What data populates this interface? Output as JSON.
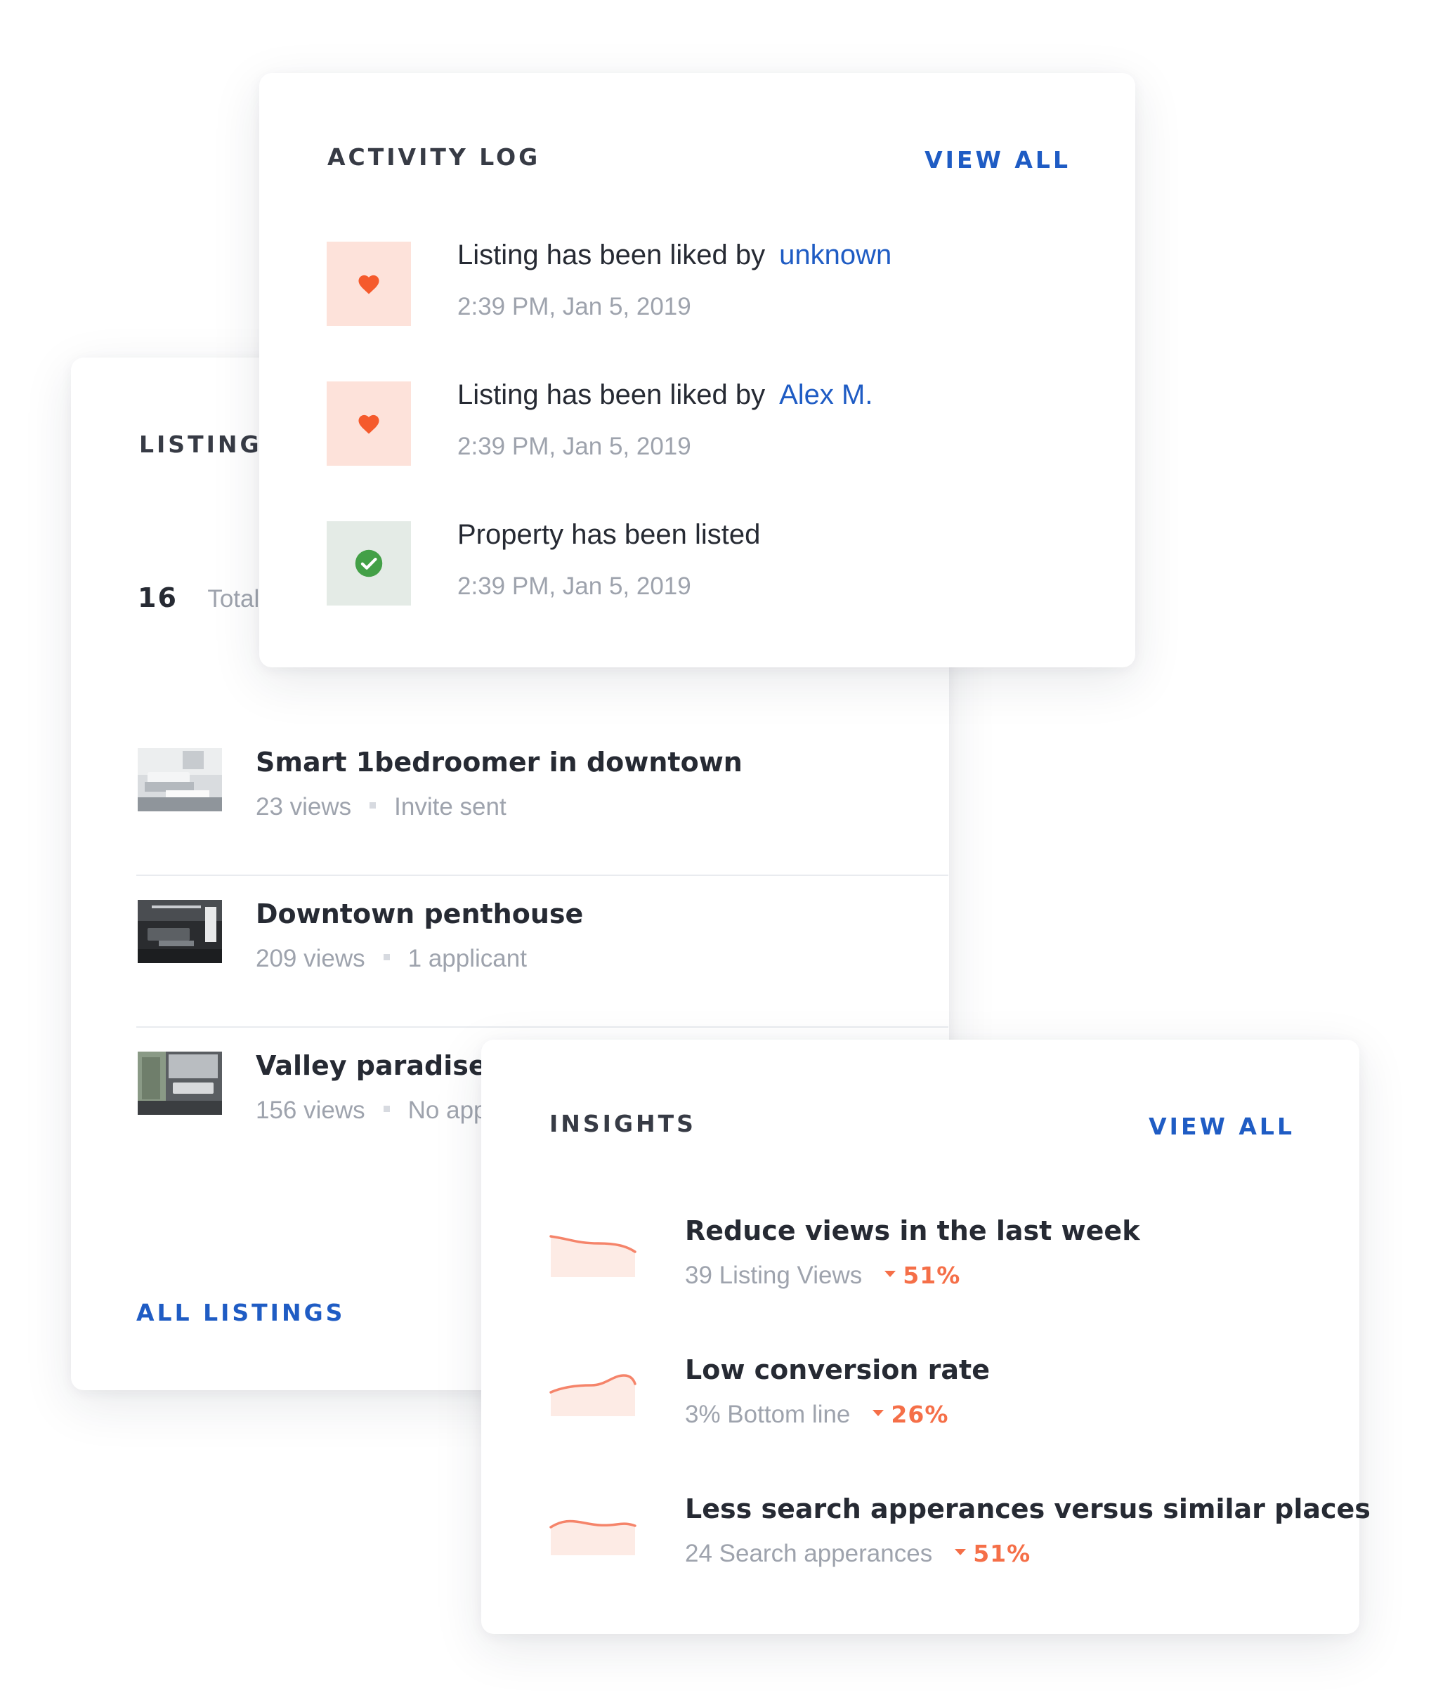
{
  "listings": {
    "heading": "LISTINGS",
    "total_count": "16",
    "total_label": "Total",
    "items": [
      {
        "title": "Smart 1bedroomer in downtown",
        "views": "23 views",
        "status": "Invite sent"
      },
      {
        "title": "Downtown penthouse",
        "views": "209 views",
        "status": "1 applicant"
      },
      {
        "title": "Valley paradise c",
        "views": "156 views",
        "status": "No app"
      }
    ],
    "all_link": "ALL LISTINGS"
  },
  "activity": {
    "heading": "ACTIVITY LOG",
    "view_all": "VIEW ALL",
    "items": [
      {
        "icon": "heart-icon",
        "text": "Listing has been liked by",
        "who": "unknown",
        "time": "2:39 PM, Jan 5, 2019"
      },
      {
        "icon": "heart-icon",
        "text": "Listing has been liked by",
        "who": "Alex M.",
        "time": "2:39 PM, Jan 5, 2019"
      },
      {
        "icon": "check-circle-icon",
        "text": "Property has been listed",
        "who": "",
        "time": "2:39 PM, Jan 5, 2019"
      }
    ]
  },
  "insights": {
    "heading": "INSIGHTS",
    "view_all": "VIEW ALL",
    "items": [
      {
        "title": "Reduce views in the last week",
        "metric": "39 Listing Views",
        "change": "51%",
        "trend": "down"
      },
      {
        "title": "Low conversion rate",
        "metric": "3% Bottom line",
        "change": "26%",
        "trend": "down"
      },
      {
        "title": "Less search apperances versus similar places",
        "metric": "24 Search apperances",
        "change": "51%",
        "trend": "down"
      }
    ]
  },
  "colors": {
    "accent_blue": "#1f5cc4",
    "heart_orange": "#f55a2c",
    "check_green": "#43a047",
    "down_orange": "#f56f48"
  }
}
